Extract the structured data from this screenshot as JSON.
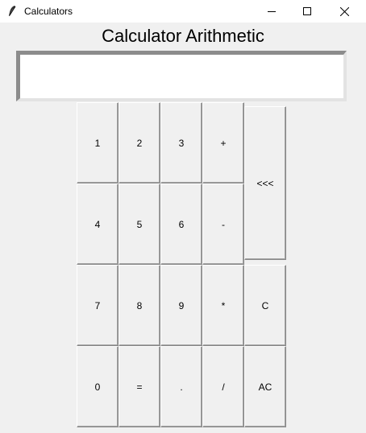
{
  "window": {
    "title": "Calculators"
  },
  "heading": "Calculator Arithmetic",
  "display": {
    "value": ""
  },
  "keys": {
    "k1": "1",
    "k2": "2",
    "k3": "3",
    "plus": "+",
    "back": "<<<",
    "k4": "4",
    "k5": "5",
    "k6": "6",
    "minus": "-",
    "k7": "7",
    "k8": "8",
    "k9": "9",
    "mul": "*",
    "clear": "C",
    "k0": "0",
    "eq": "=",
    "dot": ".",
    "div": "/",
    "allclear": "AC"
  }
}
